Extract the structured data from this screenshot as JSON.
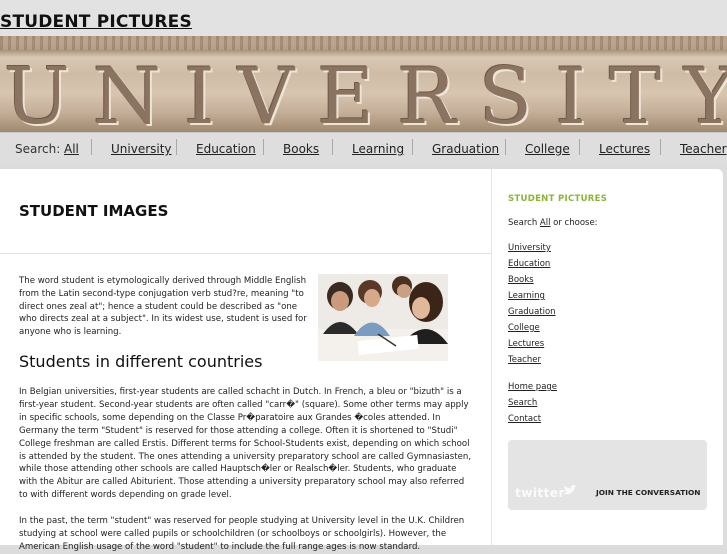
{
  "site": {
    "title": "STUDENT PICTURES",
    "banner_text": "UNIVERSITY"
  },
  "nav": {
    "label": "Search:",
    "items": [
      "All",
      "University",
      "Education",
      "Books",
      "Learning",
      "Graduation",
      "College",
      "Lectures",
      "Teacher"
    ]
  },
  "main": {
    "heading": "STUDENT IMAGES",
    "intro": "The word student is etymologically derived through Middle English from the Latin second-type conjugation verb stud?re, meaning \"to direct ones zeal at\"; hence a student could be described as \"one who directs zeal at a subject\". In its widest use, student is used for anyone who is learning.",
    "subheading": "Students in different countries",
    "para1": "In Belgian universities, first-year students are called schacht in Dutch. In French, a bleu or \"bizuth\" is a first-year student. Second-year students are often called \"carr�\" (square). Some other terms may apply in specific schools, some depending on the Classe Pr�paratoire aux Grandes �coles attended. In Germany the term \"Student\" is reserved for those attending a college. Often it is shortened to \"Studi\" College freshman are called Erstis. Different terms for School-Students exist, depending on which school is attended by the student. The ones attending a university preparatory school are called Gymnasiasten, while those attending other schools are called Hauptsch�ler or Realsch�ler. Students, who graduate with the Abitur are called Abiturient. Those attending a university preparatory school may also referred to with different words depending on grade level.",
    "para2": "In the past, the term \"student\" was reserved for people studying at University level in the U.K. Children studying at school were called pupils or schoolchildren (or schoolboys or schoolgirls). However, the American English usage of the word \"student\" to include the full range ages is now standard."
  },
  "sidebar": {
    "title": "STUDENT PICTURES",
    "search_prefix": "Search ",
    "search_all": "All",
    "search_suffix": " or choose:",
    "categories": [
      "University",
      "Education",
      "Books",
      "Learning",
      "Graduation",
      "College",
      "Lectures",
      "Teacher"
    ],
    "links": [
      "Home page",
      "Search",
      "Contact"
    ],
    "twitter_logo": "twitter",
    "join": "JOIN THE CONVERSATION"
  },
  "colors": {
    "accent": "#8cb33a",
    "twitter_blue": "#ffffff"
  }
}
